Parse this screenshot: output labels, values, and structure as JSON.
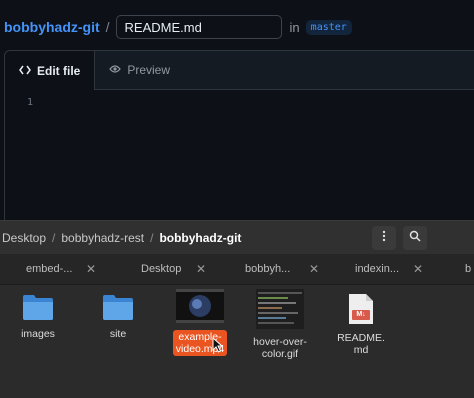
{
  "editor": {
    "repo": "bobbyhadz-git",
    "separator": "/",
    "filename": "README.md",
    "in_label": "in",
    "branch": "master",
    "tabs": [
      {
        "label": "Edit file",
        "icon": "code-icon",
        "active": true
      },
      {
        "label": "Preview",
        "icon": "eye-icon",
        "active": false
      }
    ],
    "line_number": "1"
  },
  "file_manager": {
    "path": [
      "Desktop",
      "bobbyhadz-rest",
      "bobbyhadz-git"
    ],
    "menu_icon": "kebab-menu-icon",
    "search_icon": "search-icon",
    "tabs": [
      "embed-...",
      "Desktop",
      "bobbyh...",
      "indexin...",
      "b"
    ],
    "files": [
      {
        "name": "images",
        "type": "folder"
      },
      {
        "name": "site",
        "type": "folder"
      },
      {
        "name_line1": "example-",
        "name_line2": "video.mp4",
        "type": "video",
        "selected": true
      },
      {
        "name_line1": "hover-over-",
        "name_line2": "color.gif",
        "type": "gif"
      },
      {
        "name_line1": "README.",
        "name_line2": "md",
        "type": "markdown",
        "badge": "M↓"
      }
    ],
    "accent": "#e95420"
  },
  "colors": {
    "github_bg": "#0d1117",
    "link_blue": "#4493f8",
    "fm_bg": "#2b2b2b"
  }
}
